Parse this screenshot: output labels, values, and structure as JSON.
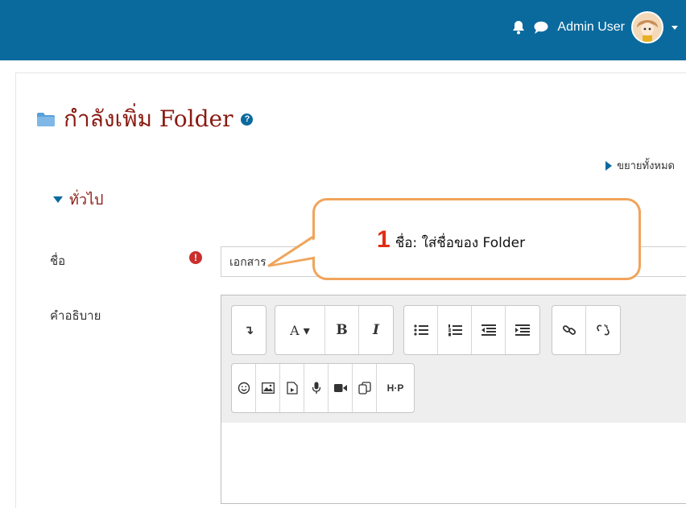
{
  "navbar": {
    "user_name": "Admin User",
    "icons": [
      "bell-icon",
      "chat-icon",
      "avatar",
      "caret-down-icon"
    ],
    "bg_color": "#0a6a9e"
  },
  "page": {
    "title": "กำลังเพิ่ม Folder",
    "title_color": "#8a1b12",
    "expand_all": "ขยายทั้งหมด"
  },
  "form": {
    "section_general": "ทั่วไป",
    "name_label": "ชื่อ",
    "name_value": "เอกสาร",
    "description_label": "คำอธิบาย"
  },
  "editor": {
    "toolbar_row1": [
      {
        "icon": "toggle-toolbar-icon",
        "label": "↴"
      },
      {
        "icon": "font-style-icon",
        "label": "A ▾"
      },
      {
        "icon": "bold-icon",
        "label": "B"
      },
      {
        "icon": "italic-icon",
        "label": "I"
      },
      {
        "icon": "bullet-list-icon"
      },
      {
        "icon": "numbered-list-icon"
      },
      {
        "icon": "outdent-icon"
      },
      {
        "icon": "indent-icon"
      },
      {
        "icon": "link-icon"
      },
      {
        "icon": "unlink-icon"
      }
    ],
    "toolbar_row2": [
      {
        "icon": "emoji-icon"
      },
      {
        "icon": "image-icon"
      },
      {
        "icon": "media-file-icon"
      },
      {
        "icon": "microphone-icon"
      },
      {
        "icon": "video-icon"
      },
      {
        "icon": "copy-icon"
      },
      {
        "icon": "h5p-icon",
        "label": "H·P"
      }
    ]
  },
  "callout": {
    "number": "1",
    "text": "ชื่อ: ใส่ชื่อของ Folder",
    "border_color": "#f0a45b",
    "number_color": "#e32d12"
  }
}
